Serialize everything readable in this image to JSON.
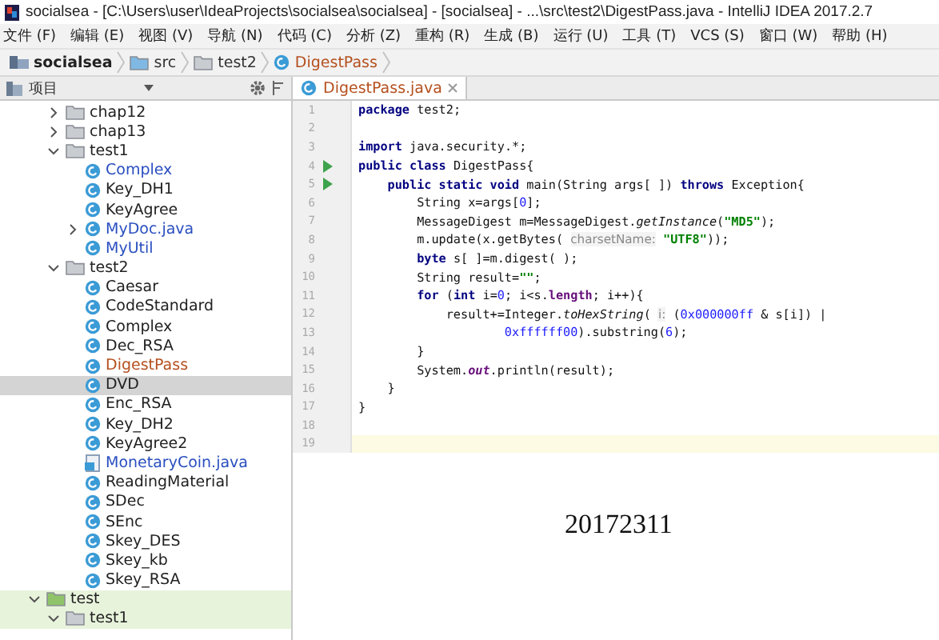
{
  "window": {
    "title": "socialsea - [C:\\Users\\user\\IdeaProjects\\socialsea\\socialsea] - [socialsea] - ...\\src\\test2\\DigestPass.java - IntelliJ IDEA 2017.2.7"
  },
  "menu": [
    "文件 (F)",
    "编辑 (E)",
    "视图 (V)",
    "导航 (N)",
    "代码 (C)",
    "分析 (Z)",
    "重构 (R)",
    "生成 (B)",
    "运行 (U)",
    "工具 (T)",
    "VCS (S)",
    "窗口 (W)",
    "帮助 (H)"
  ],
  "breadcrumb": [
    {
      "label": "socialsea",
      "kind": "module"
    },
    {
      "label": "src",
      "kind": "source-folder"
    },
    {
      "label": "test2",
      "kind": "package"
    },
    {
      "label": "DigestPass",
      "kind": "class"
    }
  ],
  "project_panel": {
    "title": "项目"
  },
  "tree": {
    "inner_items": [
      {
        "label": "chap12",
        "kind": "folder",
        "expanded": false
      },
      {
        "label": "chap13",
        "kind": "folder",
        "expanded": false
      },
      {
        "label": "test1",
        "kind": "folder",
        "expanded": true,
        "children": [
          {
            "label": "Complex",
            "kind": "class",
            "color": "#2a4fc0",
            "selected": false
          },
          {
            "label": "Key_DH1",
            "kind": "main-class",
            "color": "#222222",
            "selected": false
          },
          {
            "label": "KeyAgree",
            "kind": "main-class",
            "color": "#222222",
            "selected": false
          },
          {
            "label": "MyDoc.java",
            "kind": "main-class",
            "color": "#2a4fc0",
            "selected": false,
            "expanded": false
          },
          {
            "label": "MyUtil",
            "kind": "class",
            "color": "#2a4fc0",
            "selected": false
          }
        ]
      },
      {
        "label": "test2",
        "kind": "folder",
        "expanded": true,
        "children": [
          {
            "label": "Caesar",
            "kind": "main-class",
            "color": "#222222",
            "selected": false
          },
          {
            "label": "CodeStandard",
            "kind": "main-class",
            "color": "#222222",
            "selected": false
          },
          {
            "label": "Complex",
            "kind": "class",
            "color": "#222222",
            "selected": false
          },
          {
            "label": "Dec_RSA",
            "kind": "main-class",
            "color": "#222222",
            "selected": false
          },
          {
            "label": "DigestPass",
            "kind": "main-class",
            "color": "#b5501f",
            "selected": false
          },
          {
            "label": "DVD",
            "kind": "class",
            "color": "#222222",
            "selected": true
          },
          {
            "label": "Enc_RSA",
            "kind": "main-class",
            "color": "#222222",
            "selected": false
          },
          {
            "label": "Key_DH2",
            "kind": "main-class",
            "color": "#222222",
            "selected": false
          },
          {
            "label": "KeyAgree2",
            "kind": "main-class",
            "color": "#222222",
            "selected": false
          },
          {
            "label": "MonetaryCoin.java",
            "kind": "java-file",
            "color": "#2a4fc0",
            "selected": false
          },
          {
            "label": "ReadingMaterial",
            "kind": "class",
            "color": "#222222",
            "selected": false
          },
          {
            "label": "SDec",
            "kind": "main-class",
            "color": "#222222",
            "selected": false
          },
          {
            "label": "SEnc",
            "kind": "main-class",
            "color": "#222222",
            "selected": false
          },
          {
            "label": "Skey_DES",
            "kind": "main-class",
            "color": "#222222",
            "selected": false
          },
          {
            "label": "Skey_kb",
            "kind": "main-class",
            "color": "#222222",
            "selected": false
          },
          {
            "label": "Skey_RSA",
            "kind": "main-class",
            "color": "#222222",
            "selected": false
          }
        ]
      }
    ],
    "outer_items": [
      {
        "label": "test",
        "kind": "test-folder",
        "expanded": true,
        "children": [
          {
            "label": "test1",
            "kind": "folder",
            "expanded": true
          }
        ]
      }
    ]
  },
  "editor": {
    "tab": {
      "label": "DigestPass.java",
      "selected": true
    },
    "lines": [
      {
        "number": "1",
        "run": false,
        "current": false,
        "segments": [
          {
            "kind": "kw",
            "text": "package"
          },
          {
            "kind": "plain",
            "text": " test2;"
          }
        ]
      },
      {
        "number": "2",
        "run": false,
        "current": false
      },
      {
        "number": "3",
        "run": false,
        "current": false,
        "segments": [
          {
            "kind": "kw",
            "text": "import"
          },
          {
            "kind": "plain",
            "text": " java.security.*;"
          }
        ]
      },
      {
        "number": "4",
        "run": true,
        "current": false,
        "segments": [
          {
            "kind": "kw",
            "text": "public class"
          },
          {
            "kind": "plain",
            "text": " DigestPass{"
          }
        ]
      },
      {
        "number": "5",
        "run": true,
        "current": false,
        "segments": [
          {
            "kind": "kw",
            "text": "    public static void"
          },
          {
            "kind": "plain",
            "text": " main(String args[ ]) "
          },
          {
            "kind": "kw",
            "text": "throws"
          },
          {
            "kind": "plain",
            "text": " Exception{"
          }
        ]
      },
      {
        "number": "6",
        "run": false,
        "current": false,
        "segments": [
          {
            "kind": "plain",
            "text": "        String x=args["
          },
          {
            "kind": "num",
            "text": "0"
          },
          {
            "kind": "plain",
            "text": "];"
          }
        ]
      },
      {
        "number": "7",
        "run": false,
        "current": false,
        "segments": [
          {
            "kind": "plain",
            "text": "        MessageDigest m=MessageDigest."
          },
          {
            "kind": "italic",
            "text": "getInstance"
          },
          {
            "kind": "plain",
            "text": "("
          },
          {
            "kind": "str",
            "text": "\"MD5\""
          },
          {
            "kind": "plain",
            "text": ");"
          }
        ]
      },
      {
        "number": "8",
        "run": false,
        "current": false,
        "segments": [
          {
            "kind": "plain",
            "text": "        m.update(x.getBytes( "
          },
          {
            "kind": "hint",
            "text": "charsetName:"
          },
          {
            "kind": "str",
            "text": " \"UTF8\""
          },
          {
            "kind": "plain",
            "text": "));"
          }
        ]
      },
      {
        "number": "9",
        "run": false,
        "current": false,
        "segments": [
          {
            "kind": "kw",
            "text": "        byte"
          },
          {
            "kind": "plain",
            "text": " s[ ]=m.digest( );"
          }
        ]
      },
      {
        "number": "10",
        "run": false,
        "current": false,
        "segments": [
          {
            "kind": "plain",
            "text": "        String result="
          },
          {
            "kind": "str",
            "text": "\"\""
          },
          {
            "kind": "plain",
            "text": ";"
          }
        ]
      },
      {
        "number": "11",
        "run": false,
        "current": false,
        "segments": [
          {
            "kind": "kw",
            "text": "        for"
          },
          {
            "kind": "plain",
            "text": " ("
          },
          {
            "kind": "kw",
            "text": "int"
          },
          {
            "kind": "plain",
            "text": " i="
          },
          {
            "kind": "num",
            "text": "0"
          },
          {
            "kind": "plain",
            "text": "; i<s."
          },
          {
            "kind": "field",
            "text": "length"
          },
          {
            "kind": "plain",
            "text": "; i++){"
          }
        ]
      },
      {
        "number": "12",
        "run": false,
        "current": false,
        "segments": [
          {
            "kind": "plain",
            "text": "            result+=Integer."
          },
          {
            "kind": "italic",
            "text": "toHexString"
          },
          {
            "kind": "plain",
            "text": "( "
          },
          {
            "kind": "hint",
            "text": "i:"
          },
          {
            "kind": "plain",
            "text": " ("
          },
          {
            "kind": "num",
            "text": "0x000000ff"
          },
          {
            "kind": "plain",
            "text": " & s[i]) |"
          }
        ]
      },
      {
        "number": "13",
        "run": false,
        "current": false,
        "segments": [
          {
            "kind": "num",
            "text": "                    0xffffff00"
          },
          {
            "kind": "plain",
            "text": ").substring("
          },
          {
            "kind": "num",
            "text": "6"
          },
          {
            "kind": "plain",
            "text": ");"
          }
        ]
      },
      {
        "number": "14",
        "run": false,
        "current": false,
        "segments": [
          {
            "kind": "plain",
            "text": "        }"
          }
        ]
      },
      {
        "number": "15",
        "run": false,
        "current": false,
        "segments": [
          {
            "kind": "plain",
            "text": "        System."
          },
          {
            "kind": "field-italic",
            "text": "out"
          },
          {
            "kind": "plain",
            "text": ".println(result);"
          }
        ]
      },
      {
        "number": "16",
        "run": false,
        "current": false,
        "segments": [
          {
            "kind": "plain",
            "text": "    }"
          }
        ]
      },
      {
        "number": "17",
        "run": false,
        "current": false,
        "segments": [
          {
            "kind": "plain",
            "text": "}"
          }
        ]
      },
      {
        "number": "18",
        "run": false,
        "current": false
      },
      {
        "number": "19",
        "run": false,
        "current": true
      }
    ],
    "overlay_text": "20172311"
  }
}
